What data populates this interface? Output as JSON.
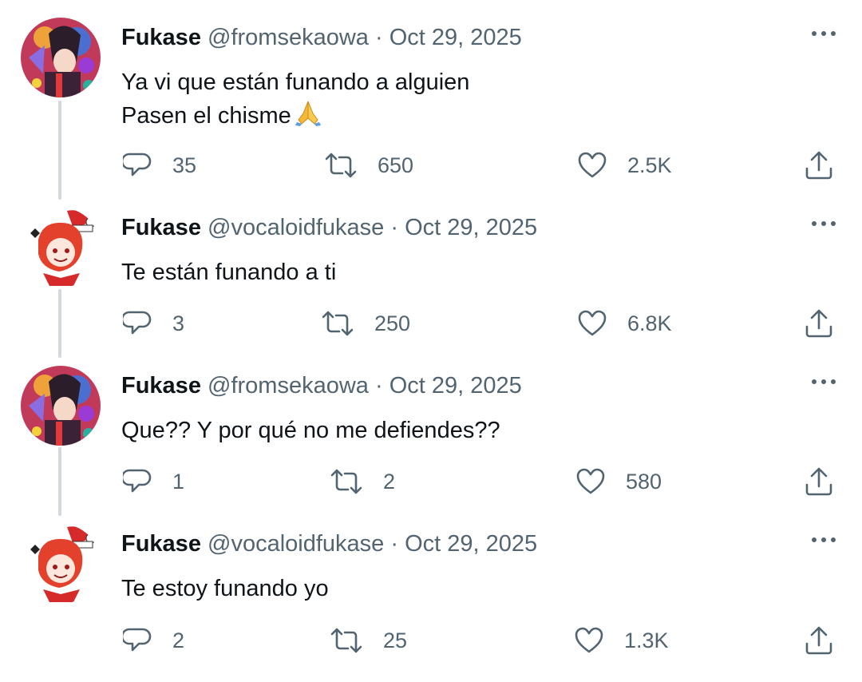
{
  "tweets": [
    {
      "name": "Fukase",
      "handle": "@fromsekaowa",
      "date": "Oct 29, 2025",
      "avatar": "fromsekaowa-avatar",
      "lines": [
        "Ya vi que están funando a alguien",
        "Pasen el chisme"
      ],
      "emoji": "🙏",
      "replies": "35",
      "retweets": "650",
      "likes": "2.5K"
    },
    {
      "name": "Fukase",
      "handle": "@vocaloidfukase",
      "date": "Oct 29, 2025",
      "avatar": "vocaloidfukase-avatar",
      "lines": [
        "Te están funando a ti"
      ],
      "replies": "3",
      "retweets": "250",
      "likes": "6.8K"
    },
    {
      "name": "Fukase",
      "handle": "@fromsekaowa",
      "date": "Oct 29, 2025",
      "avatar": "fromsekaowa-avatar",
      "lines": [
        "Que?? Y por qué no me defiendes??"
      ],
      "replies": "1",
      "retweets": "2",
      "likes": "580"
    },
    {
      "name": "Fukase",
      "handle": "@vocaloidfukase",
      "date": "Oct 29, 2025",
      "avatar": "vocaloidfukase-avatar",
      "lines": [
        "Te estoy funando yo"
      ],
      "replies": "2",
      "retweets": "25",
      "likes": "1.3K"
    }
  ],
  "separator": " · ",
  "icons": {
    "more": "more-options-icon",
    "reply": "reply-bubble-icon",
    "retweet": "retweet-icon",
    "like": "heart-icon",
    "share": "share-upload-icon"
  },
  "colors": {
    "text": "#0f1419",
    "muted": "#536471",
    "thread_line": "#cfd9de"
  }
}
